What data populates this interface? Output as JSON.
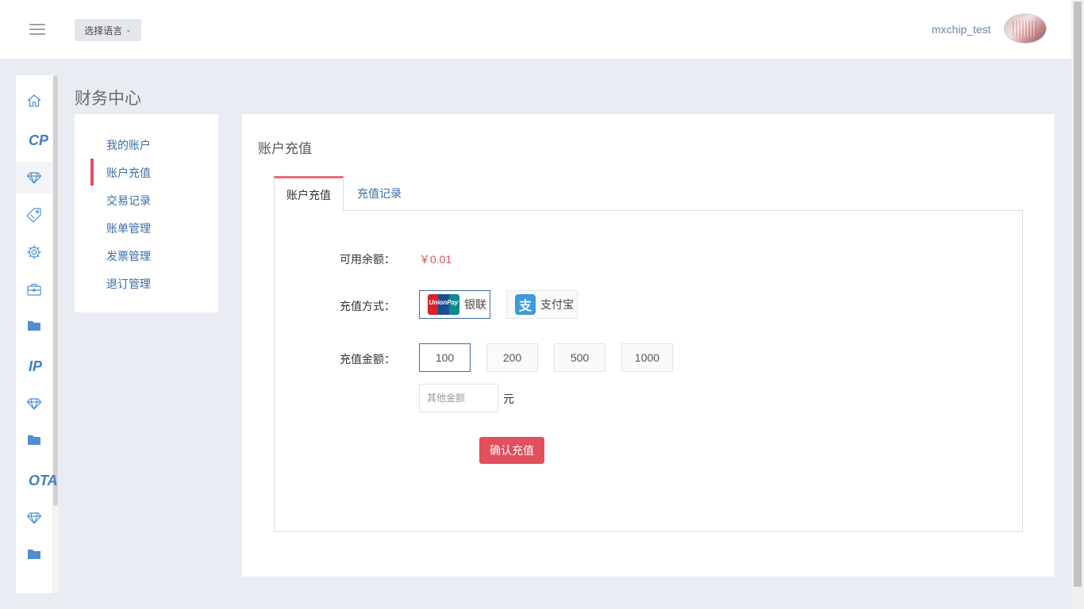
{
  "header": {
    "language_button": "选择语言",
    "username": "mxchip_test"
  },
  "sidebar": {
    "items": [
      {
        "type": "icon",
        "icon": "home-icon"
      },
      {
        "type": "text",
        "label": "CP"
      },
      {
        "type": "icon",
        "icon": "diamond-icon",
        "active": true
      },
      {
        "type": "icon",
        "icon": "tag-icon"
      },
      {
        "type": "icon",
        "icon": "gear-icon"
      },
      {
        "type": "icon",
        "icon": "briefcase-icon"
      },
      {
        "type": "icon",
        "icon": "folder-icon"
      },
      {
        "type": "text",
        "label": "IP"
      },
      {
        "type": "icon",
        "icon": "diamond-icon"
      },
      {
        "type": "icon",
        "icon": "folder-icon"
      },
      {
        "type": "text",
        "label": "OTA"
      },
      {
        "type": "icon",
        "icon": "diamond-icon"
      },
      {
        "type": "icon",
        "icon": "folder-icon"
      }
    ]
  },
  "page": {
    "title": "财务中心"
  },
  "subnav": {
    "items": [
      "我的账户",
      "账户充值",
      "交易记录",
      "账单管理",
      "发票管理",
      "退订管理"
    ],
    "active_index": 1
  },
  "main": {
    "card_title": "账户充值",
    "tabs": [
      {
        "label": "账户充值",
        "active": true
      },
      {
        "label": "充值记录",
        "active": false
      }
    ],
    "balance_label": "可用余额：",
    "balance_value": "￥0.01",
    "method_label": "充值方式：",
    "methods": [
      {
        "label": "银联",
        "logo_text": "UnionPay",
        "selected": true
      },
      {
        "label": "支付宝",
        "logo_text": "支",
        "selected": false
      }
    ],
    "amount_label": "充值金额：",
    "amounts": [
      "100",
      "200",
      "500",
      "1000"
    ],
    "selected_amount_index": 0,
    "other_amount_placeholder": "其他金额",
    "unit": "元",
    "confirm_button": "确认充值"
  },
  "colors": {
    "accent_red": "#e2505d",
    "link_blue": "#3a6ea5",
    "icon_blue": "#3d7fc4"
  }
}
